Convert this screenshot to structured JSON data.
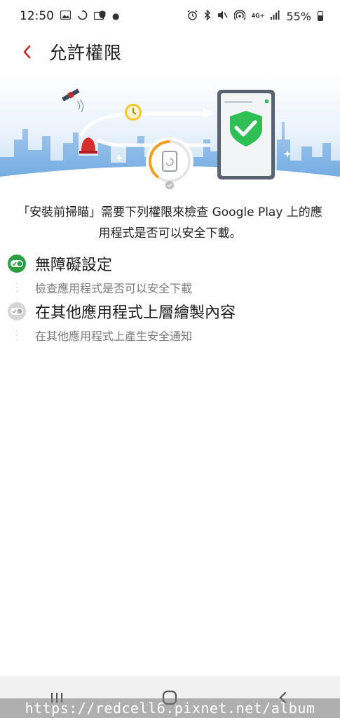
{
  "status_bar": {
    "time": "12:50",
    "battery": "55%",
    "network": "4G+",
    "icons_left": [
      "gallery-icon",
      "sync-icon",
      "shield-app-icon",
      "more-dot"
    ],
    "icons_right": [
      "alarm-icon",
      "bluetooth-icon",
      "mute-icon",
      "hotspot-icon",
      "signal-icon",
      "battery-icon"
    ]
  },
  "app_bar": {
    "title": "允許權限",
    "back_icon": "chevron-left-icon",
    "accent": "#c62828"
  },
  "description": "「安裝前掃瞄」需要下列權限來檢查 Google Play 上的應用程式是否可以安全下載。",
  "permissions": [
    {
      "title": "無障礙設定",
      "desc": "檢查應用程式是否可以安全下載",
      "enabled": true,
      "icon": "toggle-on-icon"
    },
    {
      "title": "在其他應用程式上層繪製內容",
      "desc": "在其他應用程式上產生安全通知",
      "enabled": false,
      "icon": "toggle-off-icon"
    }
  ],
  "nav_bar": {
    "buttons": [
      "recent-apps-icon",
      "home-icon",
      "back-icon"
    ]
  },
  "watermark": "https://redcell6.pixnet.net/album",
  "colors": {
    "enabled_green": "#2e9e44",
    "disabled_gray": "#a9a9a9",
    "hero_sky": "#dcebf8",
    "shield_green": "#2fbf55"
  }
}
